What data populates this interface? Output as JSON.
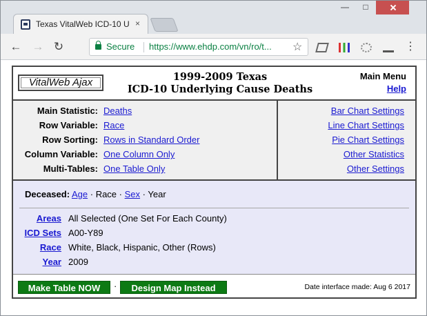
{
  "browser": {
    "tab_title": "Texas VitalWeb ICD-10 U",
    "close_glyph": "×",
    "secure_label": "Secure",
    "url": "https://www.ehdp.com/vn/ro/t..."
  },
  "header": {
    "brand": "VitalWeb Ajax",
    "title_line1": "1999-2009 Texas",
    "title_line2": "ICD-10 Underlying Cause Deaths",
    "main_menu": "Main Menu",
    "help": "Help"
  },
  "settings": {
    "rows": [
      {
        "label": "Main Statistic:",
        "value": "Deaths"
      },
      {
        "label": "Row Variable:",
        "value": "Race"
      },
      {
        "label": "Row Sorting:",
        "value": "Rows in Standard Order"
      },
      {
        "label": "Column Variable:",
        "value": "One Column Only"
      },
      {
        "label": "Multi-Tables:",
        "value": "One Table Only"
      }
    ],
    "links": [
      "Bar Chart Settings",
      "Line Chart Settings",
      "Pie Chart Settings",
      "Other Statistics",
      "Other Settings"
    ]
  },
  "query": {
    "deceased_label": "Deceased:",
    "variables": [
      "Age",
      "Race",
      "Sex",
      "Year"
    ],
    "separator": "·",
    "rows": [
      {
        "label": "Areas",
        "value": "All Selected (One Set For Each County)"
      },
      {
        "label": "ICD Sets",
        "value": "A00-Y89"
      },
      {
        "label": "Race",
        "value": "White, Black, Hispanic, Other (Rows)"
      },
      {
        "label": "Year",
        "value": "2009"
      }
    ]
  },
  "footer": {
    "make_table": "Make Table NOW",
    "separator": "·",
    "design_map": "Design Map Instead",
    "date_made": "Date interface made: Aug 6 2017"
  }
}
